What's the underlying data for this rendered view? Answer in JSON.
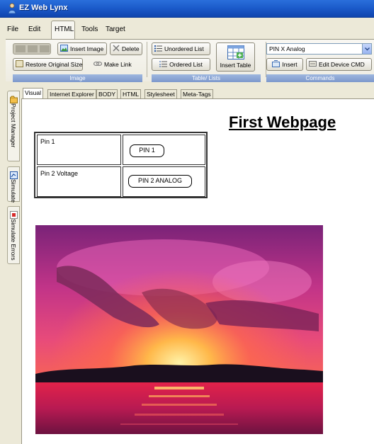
{
  "window": {
    "title": "EZ Web Lynx"
  },
  "menu": {
    "file": "File",
    "edit": "Edit",
    "html": "HTML",
    "tools": "Tools",
    "target": "Target"
  },
  "ribbon": {
    "image_group": {
      "label": "Image",
      "insert_image": "Insert Image",
      "delete": "Delete",
      "restore": "Restore Original Size",
      "make_link": "Make Link"
    },
    "table_group": {
      "label": "Table/ Lists",
      "unordered": "Unordered List",
      "ordered": "Ordered List",
      "insert_table": "Insert Table"
    },
    "commands_group": {
      "label": "Commands",
      "select_value": "PIN X Analog",
      "insert": "Insert",
      "edit_device": "Edit Device CMD"
    }
  },
  "side_tabs": [
    "Project Manager",
    "Simulate",
    "Simulate Errors"
  ],
  "editor_tabs": [
    "Visual",
    "Internet Explorer",
    "BODY",
    "HTML",
    "Stylesheet",
    "Meta-Tags"
  ],
  "page": {
    "title": "First Webpage",
    "table": [
      {
        "label": "Pin 1",
        "button": "PIN 1"
      },
      {
        "label": "Pin 2 Voltage",
        "button": "PIN 2 ANALOG"
      }
    ]
  }
}
